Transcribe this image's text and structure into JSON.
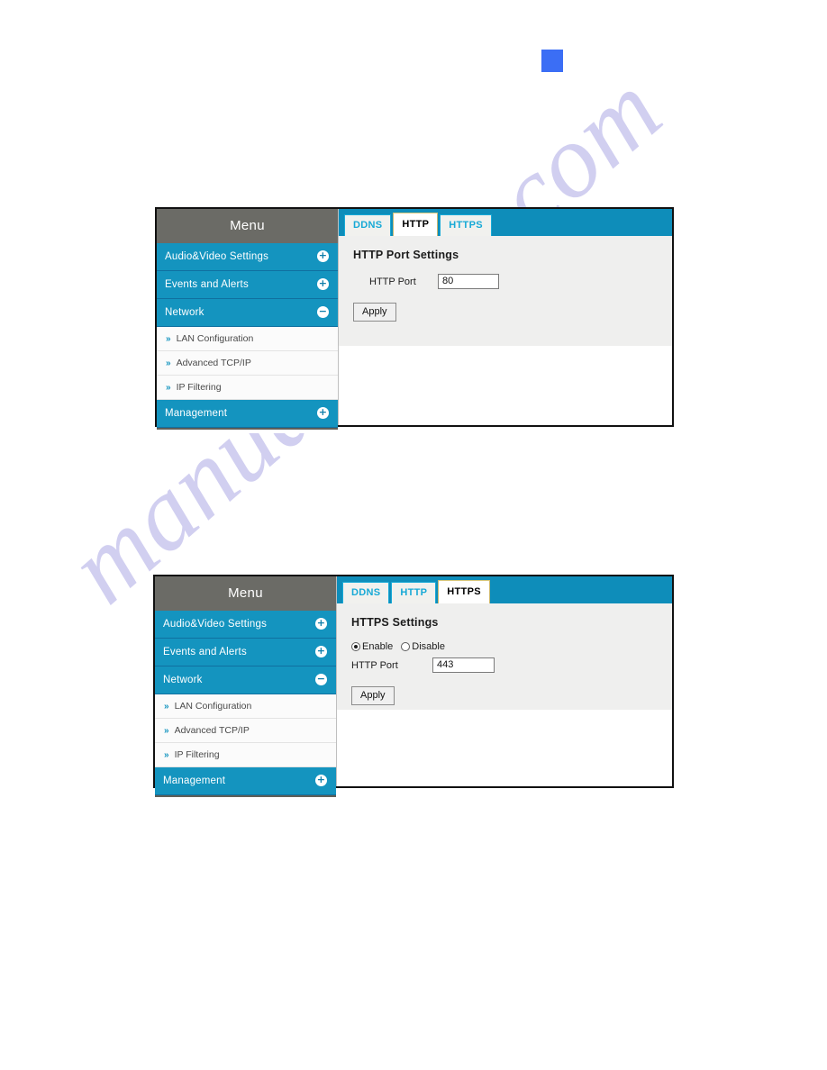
{
  "page": {
    "watermark": "manualshive.com",
    "blue_square_color": "#3b6ef5"
  },
  "colors": {
    "menu_header_bg": "#6b6b66",
    "menu_item_bg": "#1494bf",
    "tabbar_bg": "#0e8dba",
    "tab_text": "#17a9d6",
    "panel_bg": "#efefee"
  },
  "sidebar": {
    "title": "Menu",
    "items": [
      {
        "label": "Audio&Video Settings",
        "toggle": "plus-icon",
        "glyph": "+"
      },
      {
        "label": "Events and Alerts",
        "toggle": "plus-icon",
        "glyph": "+"
      },
      {
        "label": "Network",
        "toggle": "minus-icon",
        "glyph": "−"
      }
    ],
    "subitems": [
      {
        "label": "LAN Configuration",
        "chevron": "»"
      },
      {
        "label": "Advanced TCP/IP",
        "chevron": "»"
      },
      {
        "label": "IP Filtering",
        "chevron": "»"
      }
    ],
    "management": {
      "label": "Management",
      "toggle": "plus-icon",
      "glyph": "+"
    }
  },
  "figure1": {
    "tabs": [
      {
        "label": "DDNS",
        "active": false
      },
      {
        "label": "HTTP",
        "active": true
      },
      {
        "label": "HTTPS",
        "active": false
      }
    ],
    "section_title": "HTTP Port Settings",
    "port_label": "HTTP Port",
    "port_value": "80",
    "apply_label": "Apply"
  },
  "figure2": {
    "tabs": [
      {
        "label": "DDNS",
        "active": false
      },
      {
        "label": "HTTP",
        "active": false
      },
      {
        "label": "HTTPS",
        "active": true
      }
    ],
    "section_title": "HTTPS Settings",
    "enable_label": "Enable",
    "disable_label": "Disable",
    "selected_option": "Enable",
    "port_label": "HTTP Port",
    "port_value": "443",
    "apply_label": "Apply"
  }
}
